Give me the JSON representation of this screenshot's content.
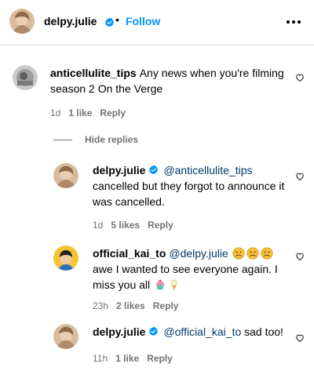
{
  "post_header": {
    "username": "delpy.julie",
    "separator": "•",
    "follow_label": "Follow"
  },
  "comments": [
    {
      "username": "anticellulite_tips",
      "text": "Any news when you're filming season 2 On the Verge",
      "time": "1d",
      "likes": "1 like",
      "reply_label": "Reply"
    }
  ],
  "hide_replies_label": "Hide replies",
  "replies": [
    {
      "username": "delpy.julie",
      "mention": "@anticellulite_tips",
      "text": "cancelled but they forgot to announce it was cancelled.",
      "time": "1d",
      "likes": "5 likes",
      "reply_label": "Reply"
    },
    {
      "username": "official_kai_to",
      "mention": "@delpy.julie",
      "text": "awe I wanted to see everyone again. I miss you all",
      "emojis_after_mention": [
        "disappointed-face",
        "disappointed-face",
        "disappointed-face"
      ],
      "emojis_after_text": [
        "cupcake",
        "ice-cream"
      ],
      "time": "23h",
      "likes": "2 likes",
      "reply_label": "Reply"
    },
    {
      "username": "delpy.julie",
      "mention": "@official_kai_to",
      "text": "sad too!",
      "time": "11h",
      "likes": "1 like",
      "reply_label": "Reply"
    }
  ],
  "colors": {
    "link": "#0095f6",
    "mention": "#00376b",
    "meta": "#737373",
    "divider": "#dbdbdb"
  },
  "icons": [
    "verified-badge-icon",
    "more-options-icon",
    "heart-icon"
  ]
}
